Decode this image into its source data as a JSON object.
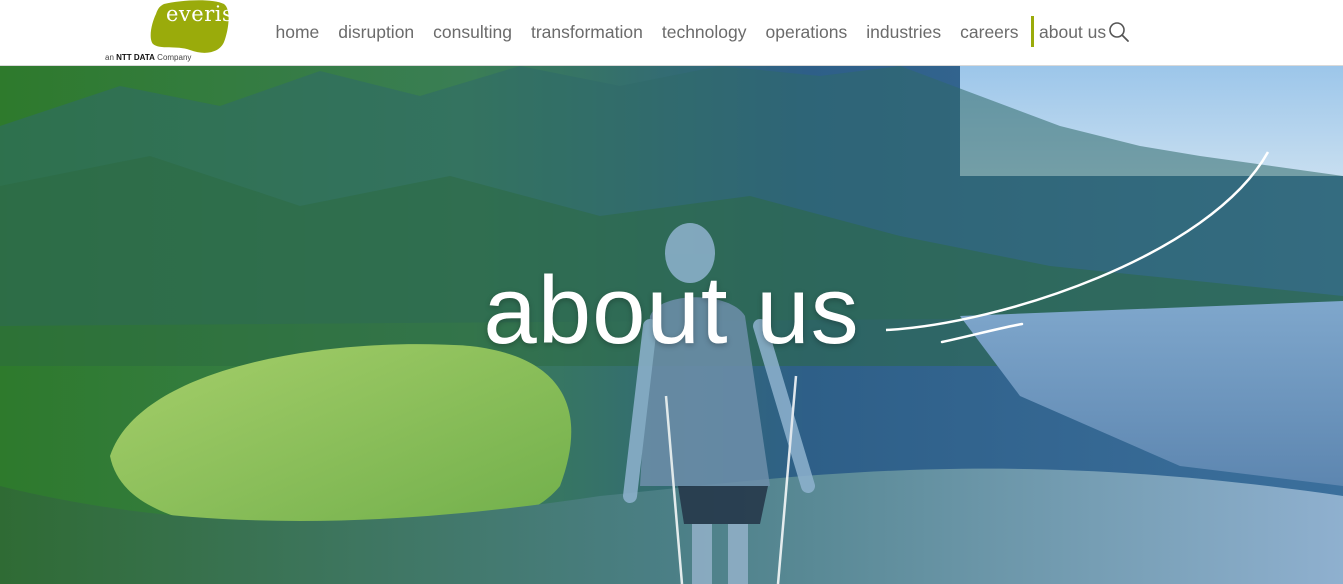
{
  "brand": {
    "logo_word": "everis",
    "tagline_prefix": "an ",
    "tagline_bold": "NTT DATA",
    "tagline_suffix": " Company",
    "logo_color": "#9aab0b"
  },
  "nav": {
    "items": [
      {
        "label": "home"
      },
      {
        "label": "disruption"
      },
      {
        "label": "consulting"
      },
      {
        "label": "transformation"
      },
      {
        "label": "technology"
      },
      {
        "label": "operations"
      },
      {
        "label": "industries"
      },
      {
        "label": "careers"
      },
      {
        "label": "about us",
        "active": true
      }
    ],
    "search_icon": "search-icon",
    "active_accent": "#9aab0b"
  },
  "hero": {
    "title": "about us",
    "image_description_colors": {
      "left_tint": "#3f8f3a",
      "right_tint": "#2f6f9a"
    }
  }
}
